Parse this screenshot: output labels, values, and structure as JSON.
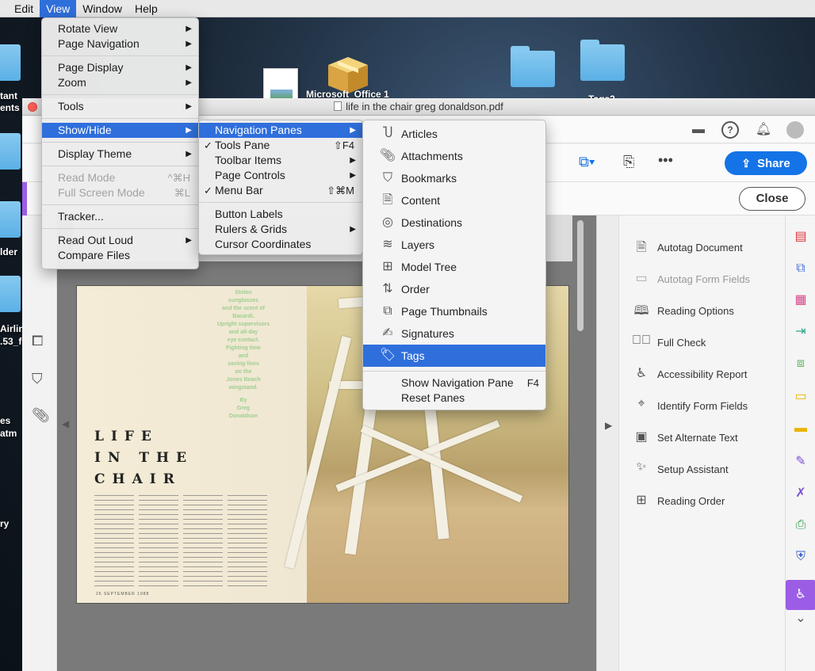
{
  "menubar": {
    "items": [
      "Edit",
      "View",
      "Window",
      "Help"
    ],
    "active": "View"
  },
  "desktop": {
    "labels": [
      "tant",
      "ents",
      "lder",
      "Airlin",
      ".53_f",
      "es",
      "atm",
      "ry",
      "Microsoft_Office 1",
      "Tags2"
    ]
  },
  "window": {
    "title": "life in the chair greg donaldson.pdf"
  },
  "toolbar": {
    "share_label": "Share",
    "close_label": "Close",
    "more_icon": "•••"
  },
  "view_menu": {
    "items": [
      {
        "label": "Rotate View",
        "submenu": true
      },
      {
        "label": "Page Navigation",
        "submenu": true
      },
      {
        "sep": true
      },
      {
        "label": "Page Display",
        "submenu": true
      },
      {
        "label": "Zoom",
        "submenu": true
      },
      {
        "sep": true
      },
      {
        "label": "Tools",
        "submenu": true
      },
      {
        "sep": true
      },
      {
        "label": "Show/Hide",
        "submenu": true,
        "highlighted": true
      },
      {
        "sep": true
      },
      {
        "label": "Display Theme",
        "submenu": true
      },
      {
        "sep": true
      },
      {
        "label": "Read Mode",
        "shortcut": "^⌘H",
        "disabled": true
      },
      {
        "label": "Full Screen Mode",
        "shortcut": "⌘L",
        "disabled": true
      },
      {
        "sep": true
      },
      {
        "label": "Tracker..."
      },
      {
        "sep": true
      },
      {
        "label": "Read Out Loud",
        "submenu": true
      },
      {
        "label": "Compare Files"
      }
    ]
  },
  "showhide_menu": {
    "items": [
      {
        "label": "Navigation Panes",
        "submenu": true,
        "highlighted": true
      },
      {
        "label": "Tools Pane",
        "shortcut": "⇧F4",
        "checked": true
      },
      {
        "label": "Toolbar Items",
        "submenu": true
      },
      {
        "label": "Page Controls",
        "submenu": true
      },
      {
        "label": "Menu Bar",
        "shortcut": "⇧⌘M",
        "checked": true
      },
      {
        "sep": true
      },
      {
        "label": "Button Labels"
      },
      {
        "label": "Rulers & Grids",
        "submenu": true
      },
      {
        "label": "Cursor Coordinates"
      }
    ]
  },
  "panes_menu": {
    "items": [
      {
        "label": "Articles",
        "icon": "articles-icon"
      },
      {
        "label": "Attachments",
        "icon": "paperclip-icon"
      },
      {
        "label": "Bookmarks",
        "icon": "bookmark-icon"
      },
      {
        "label": "Content",
        "icon": "content-icon"
      },
      {
        "label": "Destinations",
        "icon": "destinations-icon"
      },
      {
        "label": "Layers",
        "icon": "layers-icon"
      },
      {
        "label": "Model Tree",
        "icon": "model-tree-icon"
      },
      {
        "label": "Order",
        "icon": "order-icon"
      },
      {
        "label": "Page Thumbnails",
        "icon": "page-thumbnails-icon"
      },
      {
        "label": "Signatures",
        "icon": "signature-icon"
      },
      {
        "label": "Tags",
        "icon": "tag-icon",
        "highlighted": true
      }
    ],
    "footer": [
      {
        "label": "Show Navigation Pane",
        "shortcut": "F4"
      },
      {
        "label": "Reset Panes"
      }
    ]
  },
  "tools_pane": {
    "items": [
      {
        "label": "Autotag Document",
        "icon": "autotag-document-icon"
      },
      {
        "label": "Autotag Form Fields",
        "icon": "autotag-form-fields-icon",
        "disabled": true
      },
      {
        "label": "Reading Options",
        "icon": "reading-options-icon"
      },
      {
        "label": "Full Check",
        "icon": "full-check-icon"
      },
      {
        "label": "Accessibility Report",
        "icon": "accessibility-report-icon"
      },
      {
        "label": "Identify Form Fields",
        "icon": "identify-form-fields-icon"
      },
      {
        "label": "Set Alternate Text",
        "icon": "alternate-text-icon"
      },
      {
        "label": "Setup Assistant",
        "icon": "setup-assistant-icon"
      },
      {
        "label": "Reading Order",
        "icon": "reading-order-icon"
      }
    ]
  },
  "document": {
    "title_lines": [
      "LIFE",
      "IN THE",
      "CHAIR"
    ],
    "poem_lines": [
      "Stolen",
      "sunglasses",
      "and the scent of",
      "Bacardi.",
      "Upright supervisors",
      "and all-day",
      "eye contact.",
      "Fighting time",
      "and",
      "saving lives",
      "on the",
      "Jones Beach",
      "wingstand.",
      "",
      "By",
      "Greg",
      "Donaldson"
    ],
    "folio": "26  SEPTEMBER 1988"
  },
  "colors": {
    "accent": "#2f6fdc",
    "share": "#1473e6",
    "tools_purple": "#9b5de5"
  }
}
